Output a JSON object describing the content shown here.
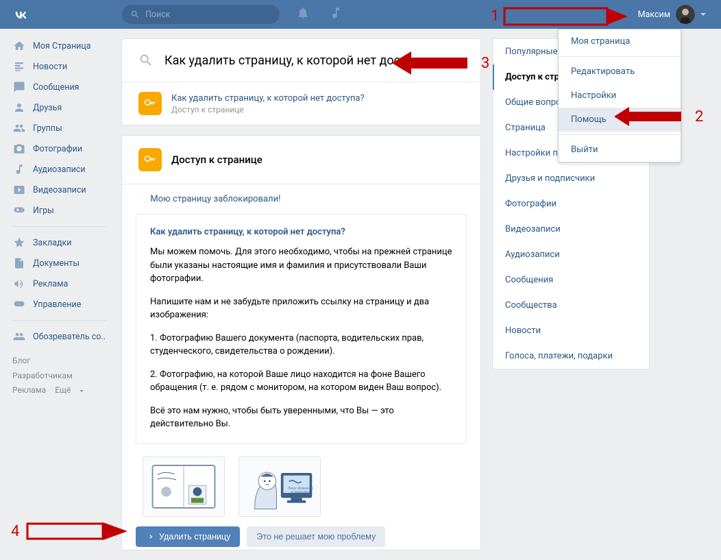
{
  "header": {
    "search_placeholder": "Поиск",
    "username": "Максим"
  },
  "sidebar": {
    "items": [
      {
        "label": "Моя Страница",
        "icon": "home"
      },
      {
        "label": "Новости",
        "icon": "news"
      },
      {
        "label": "Сообщения",
        "icon": "messages"
      },
      {
        "label": "Друзья",
        "icon": "friend"
      },
      {
        "label": "Группы",
        "icon": "groups"
      },
      {
        "label": "Фотографии",
        "icon": "photo"
      },
      {
        "label": "Аудиозаписи",
        "icon": "audio"
      },
      {
        "label": "Видеозаписи",
        "icon": "video"
      },
      {
        "label": "Игры",
        "icon": "games"
      }
    ],
    "items2": [
      {
        "label": "Закладки",
        "icon": "bookmark"
      },
      {
        "label": "Документы",
        "icon": "docs"
      },
      {
        "label": "Реклама",
        "icon": "ads"
      },
      {
        "label": "Управление",
        "icon": "manage"
      }
    ],
    "items3": [
      {
        "label": "Обозреватель со..",
        "icon": "community"
      }
    ],
    "footer": {
      "blog": "Блог",
      "dev": "Разработчикам",
      "ads": "Реклама",
      "more": "Ещё"
    }
  },
  "search_query": "Как удалить страницу, к которой нет доступа",
  "search_result": {
    "title": "Как удалить страницу, к которой нет доступа?",
    "subtitle": "Доступ к странице"
  },
  "page": {
    "title": "Доступ к странице",
    "link1": "Мою страницу заблокировали!",
    "article_title": "Как удалить страницу, к которой нет доступа?",
    "p1": "Мы можем помочь. Для этого необходимо, чтобы на прежней странице были указаны настоящие имя и фамилия и присутствовали Ваши фотографии.",
    "p2": "Напишите нам и не забудьте приложить ссылку на страницу и два изображения:",
    "p3": "1. Фотографию Вашего документа (паспорта, водительских прав, студенческого, свидетельства о рождении).",
    "p4": "2. Фотографию, на которой Ваше лицо находится на фоне Вашего обращения (т. е. рядом с монитором, на котором виден Ваш вопрос).",
    "p5": "Всё это нам нужно, чтобы быть уверенными, что Вы — это действительно Вы.",
    "btn_delete": "Удалить страницу",
    "btn_nope": "Это не решает мою проблему"
  },
  "right_nav": [
    "Популярные",
    "Доступ к странице",
    "Общие вопросы",
    "Страница",
    "Настройки приватности",
    "Друзья и подписчики",
    "Фотографии",
    "Видеозаписи",
    "Аудиозаписи",
    "Сообщения",
    "Сообщества",
    "Новости",
    "Голоса, платежи, подарки"
  ],
  "dropdown": {
    "my_page": "Моя страница",
    "edit": "Редактировать",
    "settings": "Настройки",
    "help": "Помощь",
    "logout": "Выйти"
  },
  "annotations": {
    "n1": "1",
    "n2": "2",
    "n3": "3",
    "n4": "4"
  }
}
